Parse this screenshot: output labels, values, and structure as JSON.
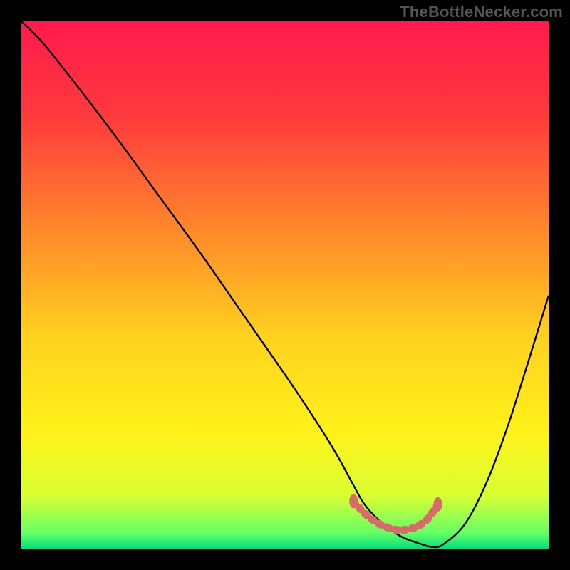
{
  "watermark": "TheBottleNecker.com",
  "chart_data": {
    "type": "line",
    "title": "",
    "xlabel": "",
    "ylabel": "",
    "xlim": [
      0,
      100
    ],
    "ylim": [
      0,
      100
    ],
    "gradient_stops": [
      {
        "offset": 0,
        "color": "#ff1a4d"
      },
      {
        "offset": 18,
        "color": "#ff3a3d"
      },
      {
        "offset": 40,
        "color": "#ff8a2a"
      },
      {
        "offset": 60,
        "color": "#ffd21f"
      },
      {
        "offset": 78,
        "color": "#fff21a"
      },
      {
        "offset": 90,
        "color": "#d9ff33"
      },
      {
        "offset": 97,
        "color": "#66ff66"
      },
      {
        "offset": 100,
        "color": "#00e07a"
      }
    ],
    "series": [
      {
        "name": "bottleneck-curve",
        "color": "#000000",
        "x": [
          0,
          4,
          10,
          18,
          26,
          34,
          42,
          50,
          56,
          60,
          63,
          65,
          68,
          72,
          76,
          78,
          80,
          84,
          88,
          92,
          96,
          100
        ],
        "y": [
          100,
          96,
          88.5,
          78,
          67,
          56,
          44.5,
          33,
          24,
          17.5,
          12,
          8.5,
          5.2,
          2.3,
          0.8,
          0.3,
          0.8,
          4.5,
          12,
          22.5,
          35,
          48
        ]
      },
      {
        "name": "optimal-band",
        "color": "#d96a6a",
        "style": "dotted-thick",
        "x": [
          63,
          65,
          67,
          69,
          71,
          73,
          75,
          77,
          79
        ],
        "y": [
          9,
          6.8,
          5.2,
          4.2,
          3.6,
          3.6,
          4.2,
          5.6,
          8.4
        ]
      }
    ],
    "annotations": []
  }
}
